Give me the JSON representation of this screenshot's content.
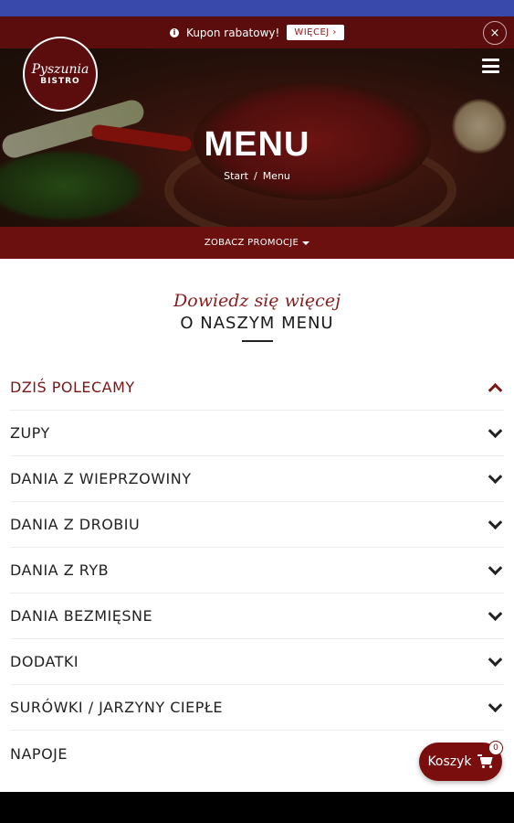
{
  "coupon": {
    "text": "Kupon rabatowy!",
    "more_label": "WIĘCEJ ›",
    "close_label": "×"
  },
  "logo": {
    "name": "Pyszunia",
    "sub": "BISTRO"
  },
  "hero": {
    "title": "MENU",
    "breadcrumb": [
      "Start",
      "/",
      "Menu"
    ]
  },
  "promo": {
    "label": "ZOBACZ PROMOCJE"
  },
  "section": {
    "subtitle": "Dowiedz się więcej",
    "title": "O NASZYM MENU"
  },
  "menu": {
    "items": [
      {
        "label": "DZIŚ POLECAMY",
        "expanded": true
      },
      {
        "label": "ZUPY",
        "expanded": false
      },
      {
        "label": "DANIA Z WIEPRZOWINY",
        "expanded": false
      },
      {
        "label": "DANIA Z DROBIU",
        "expanded": false
      },
      {
        "label": "DANIA Z RYB",
        "expanded": false
      },
      {
        "label": "DANIA BEZMIĘSNE",
        "expanded": false
      },
      {
        "label": "DODATKI",
        "expanded": false
      },
      {
        "label": "SURÓWKI / JARZYNY CIEPŁE",
        "expanded": false
      },
      {
        "label": "NAPOJE",
        "expanded": false
      }
    ]
  },
  "cart": {
    "label": "Koszyk",
    "count": "0"
  },
  "colors": {
    "brand": "#6b0f0f",
    "accent": "#7a1515",
    "status_bar": "#3949ab"
  }
}
